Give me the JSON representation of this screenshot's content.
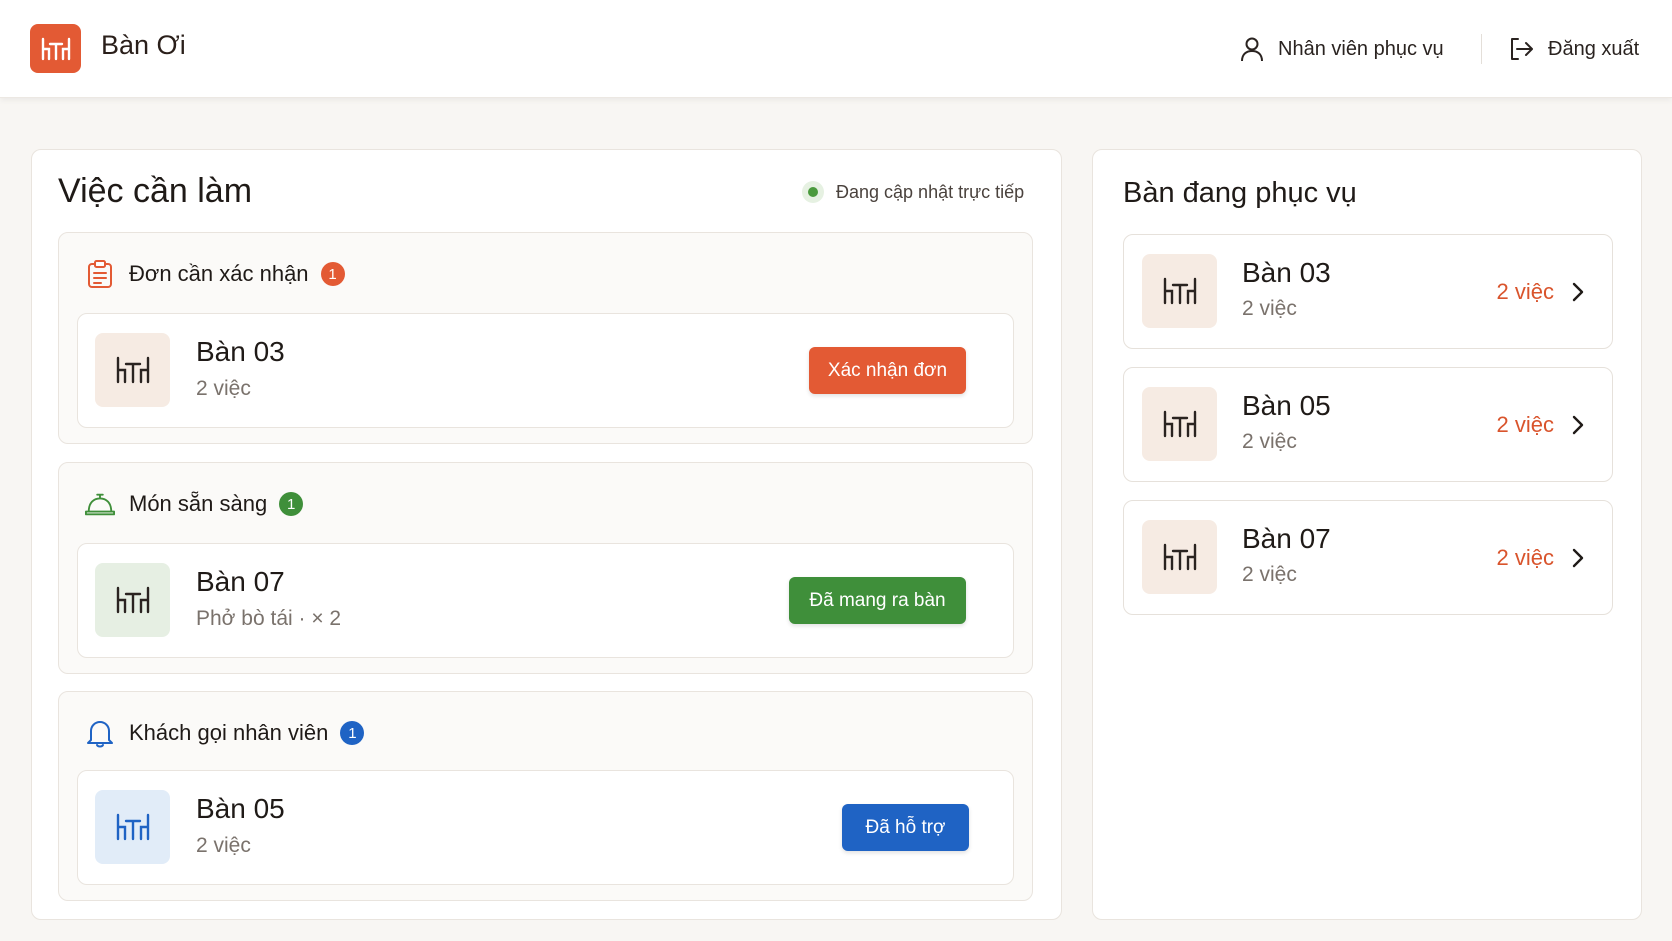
{
  "header": {
    "app_title": "Bàn Ơi",
    "user_label": "Nhân viên phục vụ",
    "logout_label": "Đăng xuất"
  },
  "tasks": {
    "title": "Việc cần làm",
    "live_status": "Đang cập nhật trực tiếp",
    "sections": [
      {
        "title": "Đơn cần xác nhận",
        "count": "1",
        "icon": "clipboard-icon",
        "accent": "#e35a34",
        "item": {
          "table": "Bàn 03",
          "detail": "2 việc",
          "action": "Xác nhận đơn"
        }
      },
      {
        "title": "Món sẵn sàng",
        "count": "1",
        "icon": "serving-dish-icon",
        "accent": "#3f8f3a",
        "item": {
          "table": "Bàn 07",
          "detail": "Phở bò tái · × 2",
          "action": "Đã mang ra bàn"
        }
      },
      {
        "title": "Khách gọi nhân viên",
        "count": "1",
        "icon": "bell-icon",
        "accent": "#1f63c4",
        "item": {
          "table": "Bàn 05",
          "detail": "2 việc",
          "action": "Đã hỗ trợ"
        }
      }
    ]
  },
  "serving": {
    "title": "Bàn đang phục vụ",
    "tables": [
      {
        "name": "Bàn 03",
        "detail": "2 việc",
        "count": "2 việc"
      },
      {
        "name": "Bàn 05",
        "detail": "2 việc",
        "count": "2 việc"
      },
      {
        "name": "Bàn 07",
        "detail": "2 việc",
        "count": "2 việc"
      }
    ]
  },
  "colors": {
    "brand": "#e35a34",
    "confirm": "#e35a34",
    "ready": "#3f8f3a",
    "support": "#1f63c4",
    "warm_thumb": "#f6ebe3",
    "green_thumb": "#e6efe3",
    "blue_thumb": "#e1ecf8"
  }
}
